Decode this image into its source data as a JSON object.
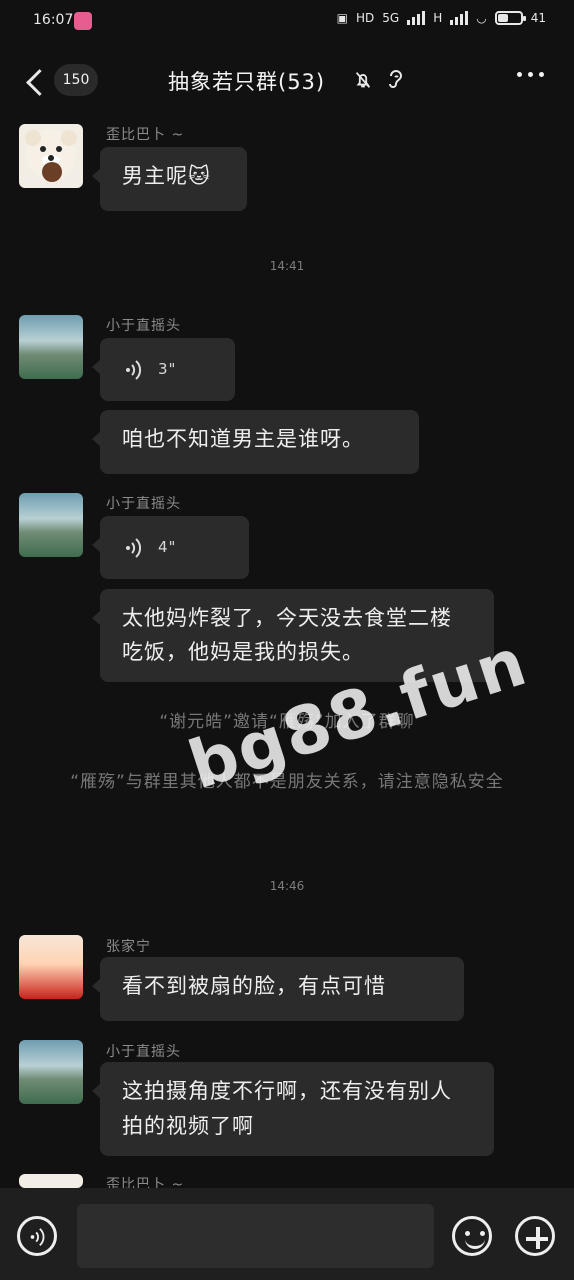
{
  "status": {
    "time": "16:07",
    "network_hd": "HD",
    "network_5g": "5G",
    "network_h": "H",
    "battery": "41",
    "battery_level": 0.41
  },
  "topbar": {
    "unread_count": "150",
    "title": "抽象若只群(53)"
  },
  "messages": [
    {
      "sender": "歪比巴卜 ~",
      "type": "text",
      "text": "男主呢🐱"
    },
    {
      "time": "14:41"
    },
    {
      "sender": "小于直摇头",
      "type": "voice",
      "duration": "3\""
    },
    {
      "type": "text",
      "text": "咱也不知道男主是谁呀。"
    },
    {
      "sender": "小于直摇头",
      "type": "voice",
      "duration": "4\""
    },
    {
      "type": "text",
      "text": "太他妈炸裂了，今天没去食堂二楼吃饭，他妈是我的损失。"
    },
    {
      "system": "“谢元皓”邀请“雁殇”加入了群聊"
    },
    {
      "system": "“雁殇”与群里其他人都不是朋友关系，请注意隐私安全"
    },
    {
      "time": "14:46"
    },
    {
      "sender": "张家宁",
      "type": "text",
      "text": "看不到被扇的脸，有点可惜"
    },
    {
      "sender": "小于直摇头",
      "type": "text",
      "text": "这拍摄角度不行啊，还有没有别人拍的视频了啊"
    },
    {
      "sender": "歪比巴卜 ~"
    }
  ],
  "watermark": "bg88.fun",
  "icons": {
    "back": "back-arrow-icon",
    "mute": "bell-slash-icon",
    "ear": "ear-icon",
    "more": "more-icon",
    "voice": "voice-icon",
    "emoji": "emoji-icon",
    "plus": "plus-icon"
  },
  "colors": {
    "background": "#111111",
    "bubble": "#2b2b2b",
    "system_highlight": "#8aa1b6"
  }
}
